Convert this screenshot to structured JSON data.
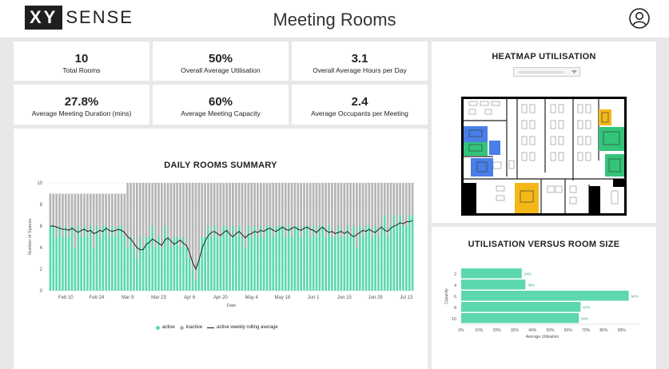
{
  "header": {
    "logo_box": "XY",
    "logo_text": "SENSE",
    "title": "Meeting Rooms"
  },
  "kpis": [
    {
      "value": "10",
      "label": "Total Rooms"
    },
    {
      "value": "50%",
      "label": "Overall Average Utilisation"
    },
    {
      "value": "3.1",
      "label": "Overall Average Hours per Day"
    },
    {
      "value": "27.8%",
      "label": "Average Meeting Duration (mins)"
    },
    {
      "value": "60%",
      "label": "Average Meeting Capacity"
    },
    {
      "value": "2.4",
      "label": "Average Occupants per Meeting"
    }
  ],
  "heatmap": {
    "title": "HEATMAP UTILISATION"
  },
  "daily": {
    "title": "DAILY ROOMS SUMMARY",
    "legend": {
      "active": "active",
      "inactive": "inactive",
      "rolling": "active weekly rolling average"
    },
    "colors": {
      "active": "#5dd8ad",
      "inactive": "#b5b5b5",
      "line": "#111111"
    }
  },
  "size_chart": {
    "title": "UTILISATION VERSUS ROOM SIZE",
    "color": "#5dd8ad"
  },
  "chart_data": [
    {
      "type": "bar",
      "title": "DAILY ROOMS SUMMARY",
      "xlabel": "Date",
      "ylabel": "Number of Spaces",
      "ylim": [
        0,
        10
      ],
      "yticks": [
        0,
        2,
        4,
        6,
        8,
        10
      ],
      "xticks": [
        "Feb 10",
        "Feb 24",
        "Mar 9",
        "Mar 23",
        "Apr 6",
        "Apr 20",
        "May 4",
        "May 18",
        "Jun 1",
        "Jun 15",
        "Jun 29",
        "Jul 13"
      ],
      "stacked": true,
      "legend": "bottom",
      "x": [
        "Feb 3",
        "Feb 4",
        "Feb 5",
        "Feb 6",
        "Feb 7",
        "Feb 10",
        "Feb 11",
        "Feb 12",
        "Feb 13",
        "Feb 14",
        "Feb 17",
        "Feb 18",
        "Feb 19",
        "Feb 20",
        "Feb 21",
        "Feb 24",
        "Feb 25",
        "Feb 26",
        "Feb 27",
        "Feb 28",
        "Mar 2",
        "Mar 3",
        "Mar 4",
        "Mar 5",
        "Mar 6",
        "Mar 9",
        "Mar 10",
        "Mar 11",
        "Mar 12",
        "Mar 13",
        "Mar 16",
        "Mar 17",
        "Mar 18",
        "Mar 19",
        "Mar 20",
        "Mar 23",
        "Mar 24",
        "Mar 25",
        "Mar 26",
        "Mar 27",
        "Mar 30",
        "Mar 31",
        "Apr 1",
        "Apr 2",
        "Apr 3",
        "Apr 6",
        "Apr 7",
        "Apr 8",
        "Apr 9",
        "Apr 10",
        "Apr 13",
        "Apr 14",
        "Apr 15",
        "Apr 16",
        "Apr 17",
        "Apr 20",
        "Apr 21",
        "Apr 22",
        "Apr 23",
        "Apr 24",
        "Apr 27",
        "Apr 28",
        "Apr 29",
        "Apr 30",
        "May 1",
        "May 4",
        "May 5",
        "May 6",
        "May 7",
        "May 8",
        "May 11",
        "May 12",
        "May 13",
        "May 14",
        "May 15",
        "May 18",
        "May 19",
        "May 20",
        "May 21",
        "May 22",
        "May 25",
        "May 26",
        "May 27",
        "May 28",
        "May 29",
        "Jun 1",
        "Jun 2",
        "Jun 3",
        "Jun 4",
        "Jun 5",
        "Jun 8",
        "Jun 9",
        "Jun 10",
        "Jun 11",
        "Jun 12",
        "Jun 15",
        "Jun 16",
        "Jun 17",
        "Jun 18",
        "Jun 19",
        "Jun 22",
        "Jun 23",
        "Jun 24",
        "Jun 25",
        "Jun 26",
        "Jun 29",
        "Jun 30",
        "Jul 1",
        "Jul 2",
        "Jul 3",
        "Jul 6",
        "Jul 7",
        "Jul 8",
        "Jul 9",
        "Jul 10",
        "Jul 13",
        "Jul 14",
        "Jul 15"
      ],
      "series": [
        {
          "name": "active",
          "values": [
            6,
            6,
            5,
            6,
            5,
            6,
            5,
            6,
            4,
            6,
            5,
            6,
            5,
            6,
            4,
            6,
            5,
            6,
            6,
            5,
            6,
            5,
            6,
            6,
            5,
            4,
            5,
            4,
            3,
            5,
            4,
            5,
            5,
            6,
            4,
            5,
            4,
            6,
            5,
            4,
            5,
            5,
            4,
            5,
            4,
            3,
            2,
            1,
            3,
            5,
            5,
            6,
            5,
            6,
            5,
            5,
            6,
            6,
            5,
            6,
            5,
            6,
            5,
            4,
            6,
            5,
            6,
            5,
            6,
            5,
            6,
            6,
            5,
            6,
            6,
            6,
            5,
            6,
            5,
            6,
            6,
            5,
            6,
            6,
            5,
            6,
            5,
            6,
            6,
            5,
            6,
            5,
            5,
            6,
            5,
            5,
            6,
            5,
            6,
            4,
            6,
            5,
            6,
            6,
            5,
            6,
            5,
            6,
            7,
            5,
            6,
            7,
            6,
            7,
            6,
            6,
            7,
            7
          ]
        },
        {
          "name": "inactive",
          "values": [
            3,
            3,
            4,
            3,
            4,
            3,
            4,
            3,
            5,
            3,
            4,
            3,
            4,
            3,
            5,
            3,
            4,
            3,
            3,
            4,
            3,
            4,
            3,
            3,
            4,
            6,
            5,
            6,
            7,
            5,
            6,
            5,
            5,
            4,
            6,
            5,
            6,
            4,
            5,
            6,
            5,
            5,
            6,
            5,
            6,
            7,
            8,
            9,
            7,
            5,
            5,
            4,
            5,
            4,
            5,
            5,
            4,
            4,
            5,
            4,
            5,
            4,
            5,
            6,
            4,
            5,
            4,
            5,
            4,
            5,
            4,
            4,
            5,
            4,
            4,
            4,
            5,
            4,
            5,
            4,
            4,
            5,
            4,
            4,
            5,
            4,
            5,
            4,
            4,
            5,
            4,
            5,
            5,
            4,
            5,
            5,
            4,
            5,
            4,
            6,
            4,
            5,
            4,
            4,
            5,
            4,
            5,
            4,
            3,
            5,
            4,
            3,
            4,
            3,
            4,
            4,
            3,
            3
          ]
        },
        {
          "name": "active weekly rolling average",
          "values": [
            6.0,
            6.0,
            5.9,
            5.8,
            5.7,
            5.7,
            5.6,
            5.8,
            5.6,
            5.4,
            5.6,
            5.7,
            5.5,
            5.6,
            5.3,
            5.4,
            5.6,
            5.5,
            5.8,
            5.6,
            5.5,
            5.6,
            5.7,
            5.6,
            5.4,
            5.0,
            4.8,
            4.4,
            4.0,
            3.8,
            3.8,
            4.3,
            4.5,
            4.8,
            4.6,
            4.4,
            4.2,
            4.7,
            4.9,
            4.6,
            4.3,
            4.5,
            4.7,
            4.4,
            4.2,
            3.5,
            2.6,
            2.0,
            2.8,
            3.9,
            4.6,
            5.1,
            5.4,
            5.5,
            5.3,
            5.1,
            5.4,
            5.6,
            5.2,
            5.0,
            5.3,
            5.5,
            5.2,
            4.9,
            5.2,
            5.3,
            5.5,
            5.4,
            5.6,
            5.5,
            5.7,
            5.8,
            5.6,
            5.5,
            5.7,
            5.9,
            5.7,
            5.6,
            5.8,
            5.9,
            5.7,
            5.6,
            5.8,
            5.9,
            5.7,
            5.6,
            5.4,
            5.7,
            5.9,
            5.6,
            5.4,
            5.5,
            5.3,
            5.4,
            5.5,
            5.3,
            5.5,
            5.2,
            5.0,
            5.2,
            5.4,
            5.6,
            5.5,
            5.7,
            5.5,
            5.4,
            5.7,
            5.9,
            5.6,
            5.5,
            5.8,
            6.0,
            6.1,
            6.3,
            6.2,
            6.4,
            6.4,
            6.5
          ]
        }
      ]
    },
    {
      "type": "bar",
      "orientation": "horizontal",
      "title": "UTILISATION VERSUS ROOM SIZE",
      "xlabel": "Average Utilisation",
      "ylabel": "Capacity",
      "categories": [
        "2",
        "4",
        "6",
        "8",
        "10"
      ],
      "values": [
        34,
        36,
        94,
        67,
        66
      ],
      "value_labels": [
        "34%",
        "36%",
        "94%",
        "67%",
        "66%"
      ],
      "xlim": [
        0,
        100
      ],
      "xticks": [
        "0%",
        "10%",
        "20%",
        "30%",
        "40%",
        "50%",
        "60%",
        "70%",
        "80%",
        "90%"
      ]
    }
  ]
}
